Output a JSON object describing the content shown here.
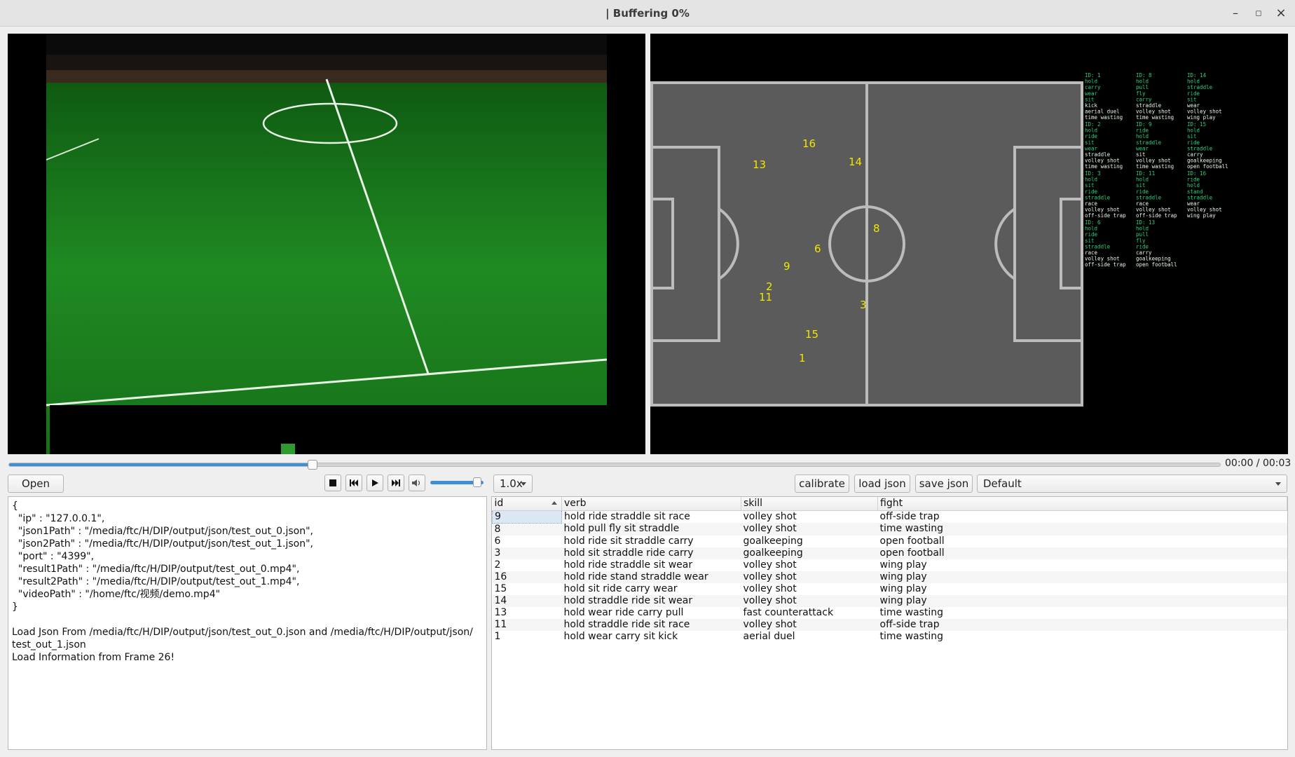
{
  "window": {
    "title": "| Buffering 0%",
    "minimize": "–",
    "maximize": "◻",
    "close": "×"
  },
  "player": {
    "time": "00:00 / 00:03",
    "progress_fraction": 0.25,
    "volume_fraction": 0.88,
    "speed": "1.0x"
  },
  "toolbar": {
    "open_label": "Open",
    "calibrate_label": "calibrate",
    "load_json_label": "load json",
    "save_json_label": "save json",
    "profile_value": "Default"
  },
  "log": {
    "text": "{\n  \"ip\" : \"127.0.0.1\",\n  \"json1Path\" : \"/media/ftc/H/DIP/output/json/test_out_0.json\",\n  \"json2Path\" : \"/media/ftc/H/DIP/output/json/test_out_1.json\",\n  \"port\" : \"4399\",\n  \"result1Path\" : \"/media/ftc/H/DIP/output/test_out_0.mp4\",\n  \"result2Path\" : \"/media/ftc/H/DIP/output/test_out_1.mp4\",\n  \"videoPath\" : \"/home/ftc/视频/demo.mp4\"\n}\n\nLoad Json From /media/ftc/H/DIP/output/json/test_out_0.json and /media/ftc/H/DIP/output/json/\ntest_out_1.json\nLoad Information from Frame 26!"
  },
  "table": {
    "headers": {
      "id": "id",
      "verb": "verb",
      "skill": "skill",
      "fight": "fight"
    },
    "rows": [
      {
        "id": "9",
        "verb": "hold ride straddle sit race",
        "skill": "volley shot",
        "fight": "off-side trap"
      },
      {
        "id": "8",
        "verb": "hold pull fly sit straddle",
        "skill": "volley shot",
        "fight": "time wasting"
      },
      {
        "id": "6",
        "verb": "hold ride sit straddle carry",
        "skill": "goalkeeping",
        "fight": "open football"
      },
      {
        "id": "3",
        "verb": "hold sit straddle ride carry",
        "skill": "goalkeeping",
        "fight": "open football"
      },
      {
        "id": "2",
        "verb": "hold ride straddle sit wear",
        "skill": "volley shot",
        "fight": "wing play"
      },
      {
        "id": "16",
        "verb": "hold ride stand straddle wear",
        "skill": "volley shot",
        "fight": "wing play"
      },
      {
        "id": "15",
        "verb": "hold sit ride carry wear",
        "skill": "volley shot",
        "fight": "wing play"
      },
      {
        "id": "14",
        "verb": "hold straddle ride sit wear",
        "skill": "volley shot",
        "fight": "wing play"
      },
      {
        "id": "13",
        "verb": "hold wear ride carry pull",
        "skill": "fast counterattack",
        "fight": "time wasting"
      },
      {
        "id": "11",
        "verb": "hold straddle ride sit race",
        "skill": "volley shot",
        "fight": "off-side trap"
      },
      {
        "id": "1",
        "verb": "hold wear carry sit kick",
        "skill": "aerial duel",
        "fight": "time wasting"
      }
    ]
  },
  "minimap": {
    "players": [
      "16",
      "13",
      "14",
      "8",
      "6",
      "9",
      "2",
      "11",
      "3",
      "15",
      "1"
    ],
    "info_blocks": [
      {
        "lines": [
          "ID: 1",
          "hold",
          "carry",
          "wear",
          "sit",
          "kick",
          "aerial duel",
          "time wasting"
        ]
      },
      {
        "lines": [
          "ID: 8",
          "hold",
          "pull",
          "fly",
          "carry",
          "straddle",
          "volley shot",
          "time wasting"
        ]
      },
      {
        "lines": [
          "ID: 14",
          "hold",
          "straddle",
          "ride",
          "sit",
          "wear",
          "volley shot",
          "wing play"
        ]
      },
      {
        "lines": [
          "ID: 2",
          "hold",
          "ride",
          "sit",
          "wear",
          "straddle",
          "volley shot",
          "time wasting"
        ]
      },
      {
        "lines": [
          "ID: 9",
          "ride",
          "hold",
          "straddle",
          "wear",
          "sit",
          "volley shot",
          "time wasting"
        ]
      },
      {
        "lines": [
          "ID: 15",
          "hold",
          "sit",
          "ride",
          "straddle",
          "carry",
          "goalkeeping",
          "open football"
        ]
      },
      {
        "lines": [
          "ID: 3",
          "hold",
          "sit",
          "ride",
          "straddle",
          "race",
          "volley shot",
          "off-side trap"
        ]
      },
      {
        "lines": [
          "ID: 11",
          "hold",
          "sit",
          "ride",
          "straddle",
          "race",
          "volley shot",
          "off-side trap"
        ]
      },
      {
        "lines": [
          "ID: 16",
          "ride",
          "hold",
          "stand",
          "straddle",
          "wear",
          "volley shot",
          "wing play"
        ]
      },
      {
        "lines": [
          "ID: 6",
          "hold",
          "ride",
          "sit",
          "straddle",
          "race",
          "volley shot",
          "off-side trap"
        ]
      },
      {
        "lines": [
          "ID: 13",
          "hold",
          "pull",
          "fly",
          "ride",
          "carry",
          "goalkeeping",
          "open football"
        ]
      }
    ]
  },
  "colors": {
    "accent": "#3d8fd6",
    "pitch_grass": "#1f7a1f",
    "minimap_pitch": "#5b5b5b",
    "minimap_text": "#f2e600",
    "info_text": "#29d17a"
  }
}
